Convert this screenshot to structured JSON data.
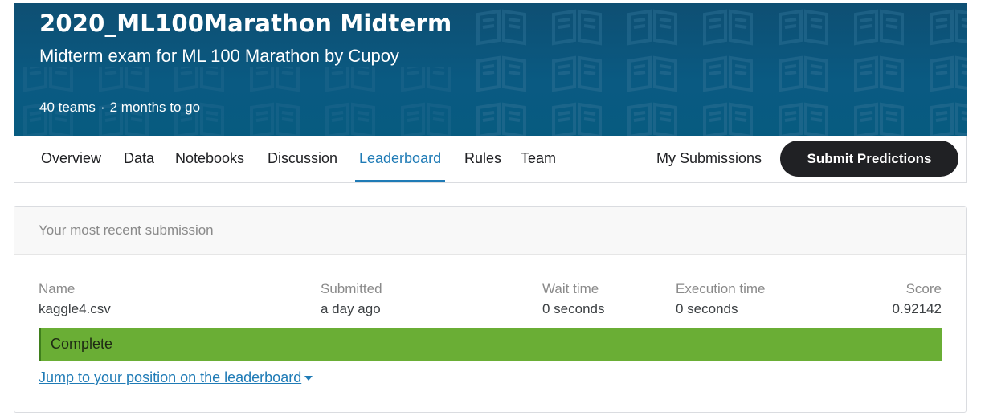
{
  "banner": {
    "title": "2020_ML100Marathon Midterm",
    "subtitle": "Midterm exam for ML 100 Marathon by Cupoy",
    "teams": "40 teams",
    "separator": "·",
    "time_left": "2 months to go",
    "pattern_icon": "open-book-icon"
  },
  "nav": {
    "tabs": [
      {
        "label": "Overview"
      },
      {
        "label": "Data"
      },
      {
        "label": "Notebooks"
      },
      {
        "label": "Discussion"
      },
      {
        "label": "Leaderboard",
        "active": true
      },
      {
        "label": "Rules"
      },
      {
        "label": "Team"
      }
    ],
    "my_submissions": "My Submissions",
    "submit_button": "Submit Predictions"
  },
  "submission": {
    "header": "Your most recent submission",
    "columns": {
      "name": {
        "label": "Name",
        "value": "kaggle4.csv"
      },
      "submitted": {
        "label": "Submitted",
        "value": "a day ago"
      },
      "wait_time": {
        "label": "Wait time",
        "value": "0 seconds"
      },
      "execution_time": {
        "label": "Execution time",
        "value": "0 seconds"
      },
      "score": {
        "label": "Score",
        "value": "0.92142"
      }
    },
    "status": "Complete",
    "jump_link": "Jump to your position on the leaderboard"
  },
  "colors": {
    "banner": "#0a5a82",
    "accent": "#1f7bb6",
    "status_green": "#6aae35",
    "button_dark": "#202124"
  }
}
